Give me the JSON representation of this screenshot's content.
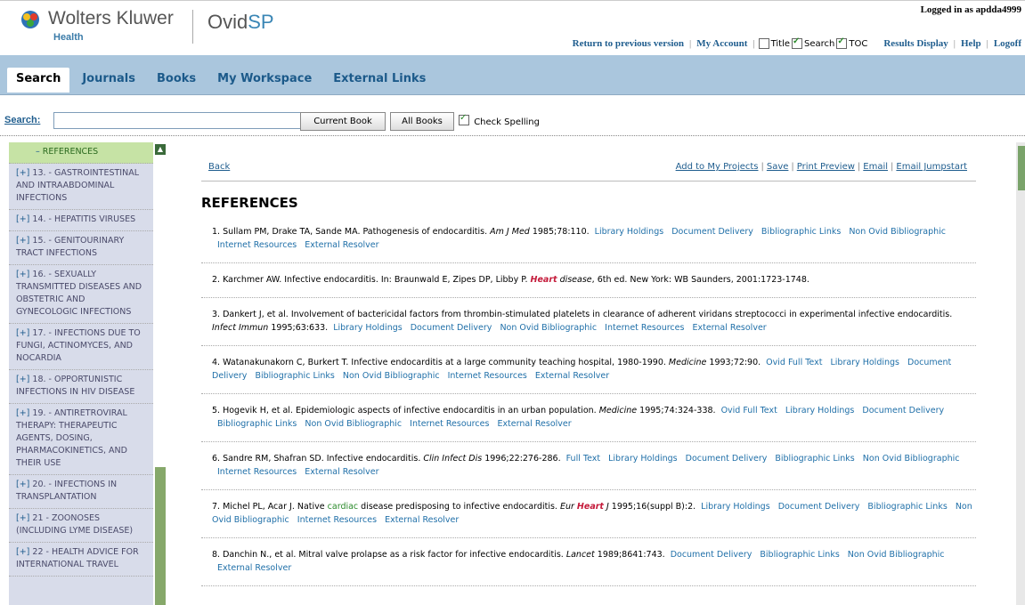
{
  "header": {
    "brand": "Wolters Kluwer",
    "brand_sub": "Health",
    "product_prefix": "Ovid",
    "product_suffix": "SP",
    "logged_in": "Logged in as apdda4999",
    "links": {
      "return_prev": "Return to previous version",
      "my_account": "My Account",
      "title": "Title",
      "search": "Search",
      "toc": "TOC",
      "results_display": "Results Display",
      "help": "Help",
      "logoff": "Logoff"
    }
  },
  "tabs": [
    "Search",
    "Journals",
    "Books",
    "My Workspace",
    "External Links"
  ],
  "search": {
    "label": "Search:",
    "value": "",
    "btn_current": "Current Book",
    "btn_all": "All Books",
    "check_spelling": "Check Spelling"
  },
  "sidebar": {
    "items": [
      {
        "pm": "–",
        "text": " REFERENCES"
      },
      {
        "pm": "[+]",
        "text": " 13. - GASTROINTESTINAL AND INTRAABDOMINAL INFECTIONS"
      },
      {
        "pm": "[+]",
        "text": " 14. - HEPATITIS VIRUSES"
      },
      {
        "pm": "[+]",
        "text": " 15. - GENITOURINARY TRACT INFECTIONS"
      },
      {
        "pm": "[+]",
        "text": " 16. - SEXUALLY TRANSMITTED DISEASES AND OBSTETRIC AND GYNECOLOGIC INFECTIONS"
      },
      {
        "pm": "[+]",
        "text": " 17. - INFECTIONS DUE TO FUNGI, ACTINOMYCES, AND NOCARDIA"
      },
      {
        "pm": "[+]",
        "text": " 18. - OPPORTUNISTIC INFECTIONS IN HIV DISEASE"
      },
      {
        "pm": "[+]",
        "text": " 19. - ANTIRETROVIRAL THERAPY: THERAPEUTIC AGENTS, DOSING, PHARMACOKINETICS, AND THEIR USE"
      },
      {
        "pm": "[+]",
        "text": " 20. - INFECTIONS IN TRANSPLANTATION"
      },
      {
        "pm": "[+]",
        "text": " 21 - ZOONOSES (INCLUDING LYME DISEASE)"
      },
      {
        "pm": "[+]",
        "text": " 22 - HEALTH ADVICE FOR INTERNATIONAL TRAVEL"
      }
    ]
  },
  "main": {
    "back": "Back",
    "actions": [
      "Add to My Projects",
      "Save",
      "Print Preview",
      "Email",
      "Email Jumpstart"
    ],
    "title": "REFERENCES",
    "refs": [
      {
        "parts": [
          {
            "t": "1. Sullam PM, Drake TA, Sande MA. Pathogenesis of endocarditis. "
          },
          {
            "t": "Am J Med",
            "style": "i"
          },
          {
            "t": " 1985;78:110."
          }
        ],
        "links": [
          "Library Holdings",
          "Document Delivery",
          "Bibliographic Links",
          "Non Ovid Bibliographic",
          "Internet Resources",
          "External Resolver"
        ]
      },
      {
        "parts": [
          {
            "t": "2. Karchmer AW. Infective endocarditis. In: Braunwald E, Zipes DP, Libby P. "
          },
          {
            "t": "Heart",
            "style": "hl"
          },
          {
            "t": " disease",
            "style": "i"
          },
          {
            "t": ", 6th ed. New York: WB Saunders, 2001:1723-1748."
          }
        ],
        "links": []
      },
      {
        "parts": [
          {
            "t": "3. Dankert J, et al. Involvement of bactericidal factors from thrombin-stimulated platelets in clearance of adherent viridans streptococci in experimental infective endocarditis. "
          },
          {
            "t": "Infect Immun",
            "style": "i"
          },
          {
            "t": " 1995;63:633."
          }
        ],
        "links": [
          "Library Holdings",
          "Document Delivery",
          "Non Ovid Bibliographic",
          "Internet Resources",
          "External Resolver"
        ]
      },
      {
        "parts": [
          {
            "t": "4. Watanakunakorn C, Burkert T. Infective endocarditis at a large community teaching hospital, 1980-1990. "
          },
          {
            "t": "Medicine",
            "style": "i"
          },
          {
            "t": " 1993;72:90."
          }
        ],
        "links": [
          "Ovid Full Text",
          "Library Holdings",
          "Document Delivery",
          "Bibliographic Links",
          "Non Ovid Bibliographic",
          "Internet Resources",
          "External Resolver"
        ]
      },
      {
        "parts": [
          {
            "t": "5. Hogevik H, et al. Epidemiologic aspects of infective endocarditis in an urban population. "
          },
          {
            "t": "Medicine",
            "style": "i"
          },
          {
            "t": " 1995;74:324-338."
          }
        ],
        "links": [
          "Ovid Full Text",
          "Library Holdings",
          "Document Delivery",
          "Bibliographic Links",
          "Non Ovid Bibliographic",
          "Internet Resources",
          "External Resolver"
        ]
      },
      {
        "parts": [
          {
            "t": "6. Sandre RM, Shafran SD. Infective endocarditis. "
          },
          {
            "t": "Clin Infect Dis",
            "style": "i"
          },
          {
            "t": " 1996;22:276-286."
          }
        ],
        "links": [
          "Full Text",
          "Library Holdings",
          "Document Delivery",
          "Bibliographic Links",
          "Non Ovid Bibliographic",
          "Internet Resources",
          "External Resolver"
        ]
      },
      {
        "parts": [
          {
            "t": "7. Michel PL, Acar J. Native "
          },
          {
            "t": "cardiac",
            "style": "gr"
          },
          {
            "t": " disease predisposing to infective endocarditis. "
          },
          {
            "t": "Eur ",
            "style": "i"
          },
          {
            "t": "Heart",
            "style": "hl"
          },
          {
            "t": " J",
            "style": "i"
          },
          {
            "t": " 1995;16(suppl B):2."
          }
        ],
        "links": [
          "Library Holdings",
          "Document Delivery",
          "Bibliographic Links",
          "Non Ovid Bibliographic",
          "Internet Resources",
          "External Resolver"
        ]
      },
      {
        "parts": [
          {
            "t": "8. Danchin N., et al. Mitral valve prolapse as a risk factor for infective endocarditis. "
          },
          {
            "t": "Lancet",
            "style": "i"
          },
          {
            "t": " 1989;8641:743."
          }
        ],
        "links": [
          "Document Delivery",
          "Bibliographic Links",
          "Non Ovid Bibliographic",
          "External Resolver"
        ]
      }
    ]
  }
}
